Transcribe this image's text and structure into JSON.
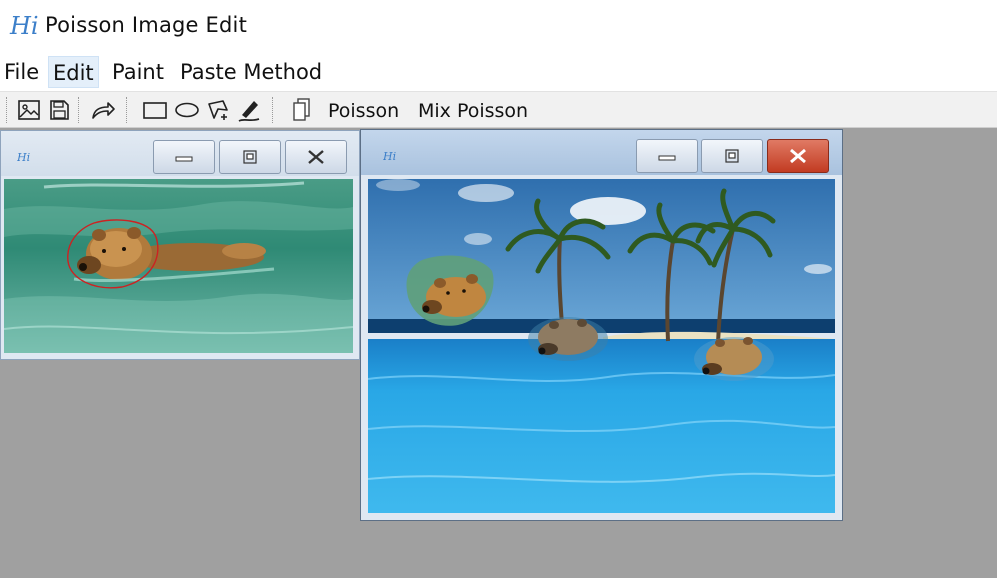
{
  "app": {
    "title": "Poisson Image Edit",
    "icon": "hi-logo-icon"
  },
  "menu": [
    {
      "label": "File",
      "active": false
    },
    {
      "label": "Edit",
      "active": true
    },
    {
      "label": "Paint",
      "active": false
    },
    {
      "label": "Paste Method",
      "active": false
    }
  ],
  "toolbar": {
    "icons": [
      "open-image-icon",
      "save-icon",
      "redo-arrow-icon",
      "rectangle-tool-icon",
      "ellipse-tool-icon",
      "polygon-tool-icon",
      "freehand-pen-icon",
      "copy-icon"
    ],
    "poisson_label": "Poisson",
    "mix_poisson_label": "Mix Poisson"
  },
  "windows": {
    "source": {
      "icon": "hi-logo-icon",
      "content": "bear-swimming-photo"
    },
    "target": {
      "icon": "hi-logo-icon",
      "content": "tropical-island-photo"
    }
  },
  "colors": {
    "close_button": "#c9422a",
    "workspace": "#a0a0a0",
    "selection_stroke": "#cc2222"
  }
}
